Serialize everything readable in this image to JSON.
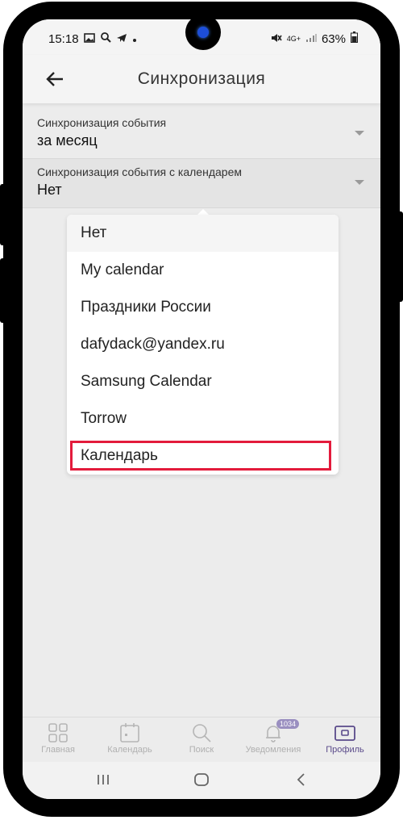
{
  "status_bar": {
    "time": "15:18",
    "network": "4G+",
    "battery": "63%"
  },
  "app_bar": {
    "title": "Синхронизация"
  },
  "settings": [
    {
      "label": "Синхронизация события",
      "value": "за месяц"
    },
    {
      "label": "Синхронизация события с календарем",
      "value": "Нет"
    }
  ],
  "dropdown": {
    "options": [
      "Нет",
      "My calendar",
      "Праздники России",
      "dafydack@yandex.ru",
      "Samsung Calendar",
      "Torrow",
      "Календарь"
    ],
    "selected": "Нет",
    "highlighted": "Календарь",
    "highlight_color": "#e31b3c"
  },
  "bottom_nav": {
    "items": [
      {
        "label": "Главная",
        "icon": "grid-icon"
      },
      {
        "label": "Календарь",
        "icon": "calendar-icon"
      },
      {
        "label": "Поиск",
        "icon": "search-icon"
      },
      {
        "label": "Уведомления",
        "icon": "bell-icon",
        "badge": "1034"
      },
      {
        "label": "Профиль",
        "icon": "profile-card-icon",
        "active": true
      }
    ]
  },
  "colors": {
    "active_nav": "#5a4a8a",
    "badge": "#9a8fc0"
  }
}
